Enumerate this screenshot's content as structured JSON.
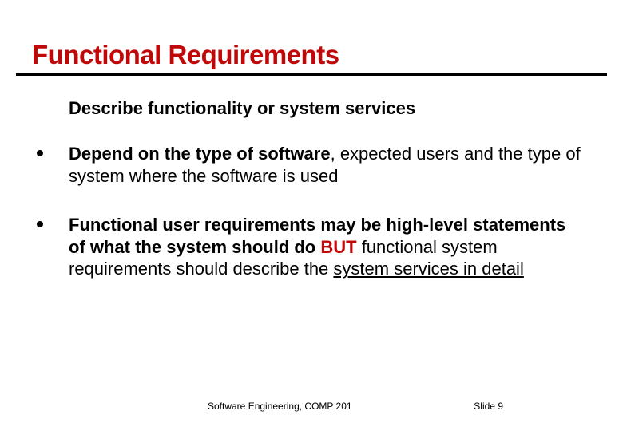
{
  "title": "Functional Requirements",
  "intro": "Describe functionality or system services",
  "bullets": [
    {
      "parts": {
        "bold1": "Depend on the type of software",
        "rest1": ", expected users and the type of system where the software is used"
      }
    },
    {
      "parts": {
        "bold1": "Functional user requirements may be high-level statements of what the system should do ",
        "but": "BUT",
        "rest1": " functional system requirements should describe the ",
        "under": "system services in detail"
      }
    }
  ],
  "footer": {
    "left": "Software Engineering, COMP 201",
    "right": "Slide  9"
  }
}
